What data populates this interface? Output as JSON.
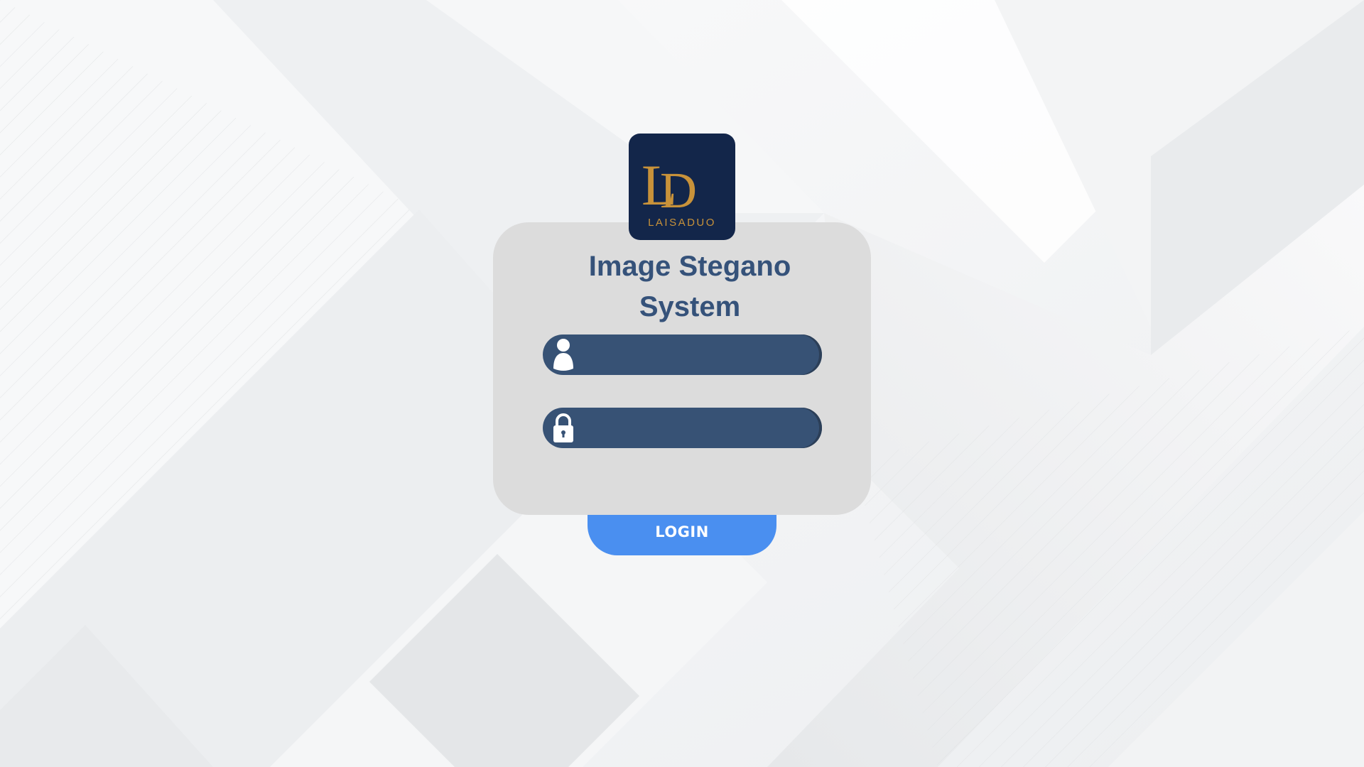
{
  "app": {
    "title": "Image Stegano System",
    "title_line1": "Image Stegano",
    "title_line2": "System"
  },
  "logo": {
    "monogram": "LD",
    "brand_text": "LAISADUO",
    "background_color": "#13264a",
    "accent_color": "#c8923a"
  },
  "form": {
    "username": {
      "icon": "user-icon",
      "value": "",
      "placeholder": ""
    },
    "password": {
      "icon": "lock-icon",
      "value": "",
      "placeholder": ""
    },
    "field_color": "#375275"
  },
  "login_button": {
    "label": "LOGIN",
    "color": "#4a8ff0"
  },
  "card_color": "#dcdcdc",
  "title_color": "#35527a"
}
